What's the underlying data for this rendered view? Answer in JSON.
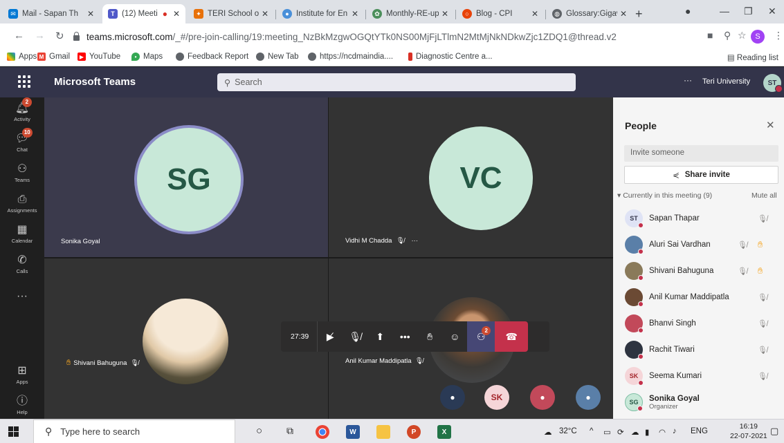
{
  "browser": {
    "tabs": [
      {
        "title": "Mail - Sapan Th",
        "favicon": "mail-icon",
        "color": "#0078d4",
        "active": false
      },
      {
        "title": "(12) Meeti",
        "favicon": "teams-icon",
        "color": "#5059c9",
        "active": true
      },
      {
        "title": "TERI School of",
        "favicon": "teri-icon",
        "color": "#e8710a",
        "active": false
      },
      {
        "title": "Institute for En",
        "favicon": "institute-icon",
        "color": "#4a90d9",
        "active": false
      },
      {
        "title": "Monthly-RE-up",
        "favicon": "monthly-icon",
        "color": "#4c8f5c",
        "active": false
      },
      {
        "title": "Blog - CPI",
        "favicon": "cpi-icon",
        "color": "#e8430a",
        "active": false
      },
      {
        "title": "Glossary:Gigaw",
        "favicon": "globe-icon",
        "color": "#5f6368",
        "active": false
      }
    ],
    "url_host": "teams.microsoft.com",
    "url_path": "/_#/pre-join-calling/19:meeting_NzBkMzgwOGQtYTk0NS00MjFjLTlmN2MtMjNkNDkwZjc1ZDQ1@thread.v2",
    "profile_initial": "S",
    "bookmarks": [
      {
        "label": "Apps",
        "icon": "apps-grid-icon",
        "color": "#ea4335"
      },
      {
        "label": "Gmail",
        "icon": "gmail-icon",
        "color": "#ea4335"
      },
      {
        "label": "YouTube",
        "icon": "youtube-icon",
        "color": "#ff0000"
      },
      {
        "label": "Maps",
        "icon": "maps-pin-icon",
        "color": "#34a853"
      },
      {
        "label": "Feedback Report",
        "icon": "globe-icon",
        "color": "#5f6368"
      },
      {
        "label": "New Tab",
        "icon": "globe-icon",
        "color": "#5f6368"
      },
      {
        "label": "https://ncdmaindia....",
        "icon": "globe-icon",
        "color": "#5f6368"
      },
      {
        "label": "Diagnostic Centre a...",
        "icon": "diagnostic-icon",
        "color": "#d93025"
      }
    ],
    "reading_list": "Reading list"
  },
  "teams": {
    "title": "Microsoft Teams",
    "search_placeholder": "Search",
    "org_name": "Teri University",
    "user_initials": "ST",
    "rail": [
      {
        "label": "Activity",
        "icon": "bell-icon",
        "badge": "2"
      },
      {
        "label": "Chat",
        "icon": "chat-icon",
        "badge": "10"
      },
      {
        "label": "Teams",
        "icon": "teams-icon",
        "badge": ""
      },
      {
        "label": "Assignments",
        "icon": "assignments-icon",
        "badge": ""
      },
      {
        "label": "Calendar",
        "icon": "calendar-icon",
        "badge": ""
      },
      {
        "label": "Calls",
        "icon": "phone-icon",
        "badge": ""
      },
      {
        "label": "",
        "icon": "more-icon",
        "badge": ""
      },
      {
        "label": "Apps",
        "icon": "apps-icon",
        "badge": ""
      },
      {
        "label": "Help",
        "icon": "help-icon",
        "badge": ""
      }
    ]
  },
  "stage": {
    "tiles": [
      {
        "name": "Sonika Goyal",
        "initials": "SG",
        "muted": false,
        "hand": false
      },
      {
        "name": "Vidhi M Chadda",
        "initials": "VC",
        "muted": true,
        "hand": false
      },
      {
        "name": "Shivani Bahuguna",
        "initials": "",
        "muted": true,
        "hand": true
      },
      {
        "name": "Anil Kumar Maddipatla",
        "initials": "",
        "muted": true,
        "hand": false
      }
    ],
    "timer": "27:39",
    "people_count": "2",
    "overflow": [
      "SK"
    ]
  },
  "people": {
    "title": "People",
    "invite_placeholder": "Invite someone",
    "share_label": "Share invite",
    "section_label": "Currently in this meeting (9)",
    "mute_all": "Mute all",
    "list": [
      {
        "name": "Sapan Thapar",
        "initials": "ST",
        "color": "#dfe3f5",
        "text": "#33344a",
        "mic": true,
        "hand": false,
        "sub": ""
      },
      {
        "name": "Aluri Sai Vardhan",
        "initials": "",
        "color": "#5a7fa8",
        "text": "#fff",
        "mic": true,
        "hand": true,
        "sub": ""
      },
      {
        "name": "Shivani Bahuguna",
        "initials": "",
        "color": "#8a7a5a",
        "text": "#fff",
        "mic": true,
        "hand": true,
        "sub": ""
      },
      {
        "name": "Anil Kumar Maddipatla",
        "initials": "",
        "color": "#6b4a34",
        "text": "#fff",
        "mic": true,
        "hand": false,
        "sub": ""
      },
      {
        "name": "Bhanvi Singh",
        "initials": "",
        "color": "#c2495a",
        "text": "#fff",
        "mic": true,
        "hand": false,
        "sub": ""
      },
      {
        "name": "Rachit Tiwari",
        "initials": "",
        "color": "#2e3440",
        "text": "#fff",
        "mic": true,
        "hand": false,
        "sub": ""
      },
      {
        "name": "Seema Kumari",
        "initials": "SK",
        "color": "#f5d5d8",
        "text": "#a4262c",
        "mic": true,
        "hand": false,
        "sub": ""
      },
      {
        "name": "Sonika Goyal",
        "initials": "SG",
        "color": "#c8e8d8",
        "text": "#255845",
        "mic": false,
        "hand": false,
        "sub": "Organizer"
      }
    ]
  },
  "taskbar": {
    "search_placeholder": "Type here to search",
    "weather": "32°C",
    "language": "ENG",
    "time": "16:19",
    "date": "22-07-2021"
  }
}
